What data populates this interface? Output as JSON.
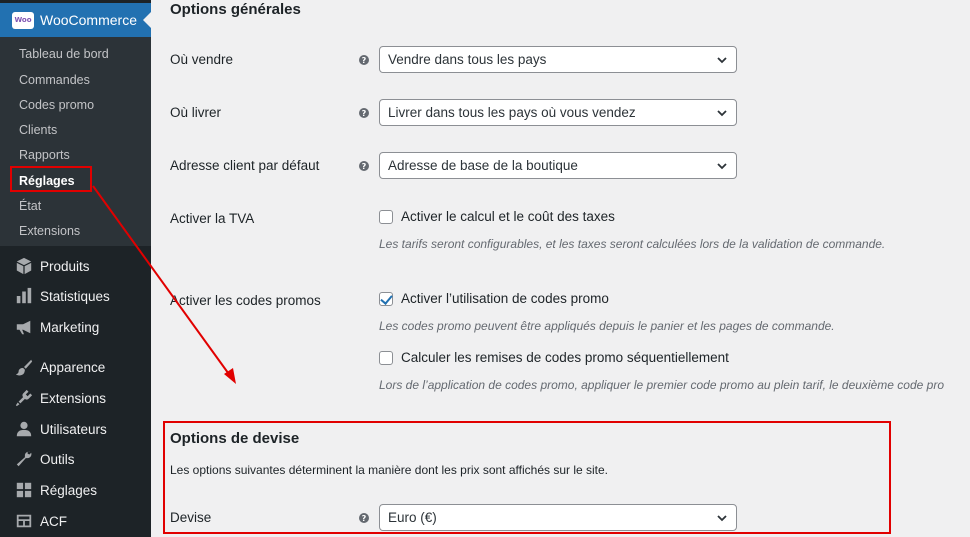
{
  "sidebar": {
    "woocommerce": {
      "logo_text": "Woo",
      "label": "WooCommerce"
    },
    "submenu": [
      {
        "label": "Tableau de bord"
      },
      {
        "label": "Commandes"
      },
      {
        "label": "Codes promo"
      },
      {
        "label": "Clients"
      },
      {
        "label": "Rapports"
      },
      {
        "label": "Réglages",
        "current": true
      },
      {
        "label": "État"
      },
      {
        "label": "Extensions"
      }
    ],
    "menu": [
      {
        "label": "Produits",
        "icon": "box-icon"
      },
      {
        "label": "Statistiques",
        "icon": "bar-chart-icon"
      },
      {
        "label": "Marketing",
        "icon": "megaphone-icon"
      },
      {
        "label": "Apparence",
        "icon": "paintbrush-icon"
      },
      {
        "label": "Extensions",
        "icon": "plugin-icon"
      },
      {
        "label": "Utilisateurs",
        "icon": "user-icon"
      },
      {
        "label": "Outils",
        "icon": "wrench-icon"
      },
      {
        "label": "Réglages",
        "icon": "settings-icon"
      },
      {
        "label": "ACF",
        "icon": "acf-grid-icon"
      }
    ]
  },
  "general": {
    "title": "Options générales",
    "ou_vendre": {
      "label": "Où vendre",
      "value": "Vendre dans tous les pays"
    },
    "ou_livrer": {
      "label": "Où livrer",
      "value": "Livrer dans tous les pays où vous vendez"
    },
    "adresse": {
      "label": "Adresse client par défaut",
      "value": "Adresse de base de la boutique"
    },
    "tva": {
      "label": "Activer la TVA",
      "checkbox_label": "Activer le calcul et le coût des taxes",
      "checked": false,
      "description": "Les tarifs seront configurables, et les taxes seront calculées lors de la validation de commande."
    },
    "codes_promo": {
      "label": "Activer les codes promos",
      "checkbox_label": "Activer l’utilisation de codes promo",
      "checked": true,
      "description": "Les codes promo peuvent être appliqués depuis le panier et les pages de commande.",
      "sequential_label": "Calculer les remises de codes promo séquentiellement",
      "sequential_checked": false,
      "sequential_description": "Lors de l’application de codes promo, appliquer le premier code promo au plein tarif, le deuxième code pro"
    }
  },
  "currency": {
    "title": "Options de devise",
    "description": "Les options suivantes déterminent la manière dont les prix sont affichés sur le site.",
    "devise": {
      "label": "Devise",
      "value": "Euro (€)"
    }
  },
  "colors": {
    "annotation": "#e10000",
    "accent": "#2271b1",
    "sidebar": "#1d2327"
  }
}
